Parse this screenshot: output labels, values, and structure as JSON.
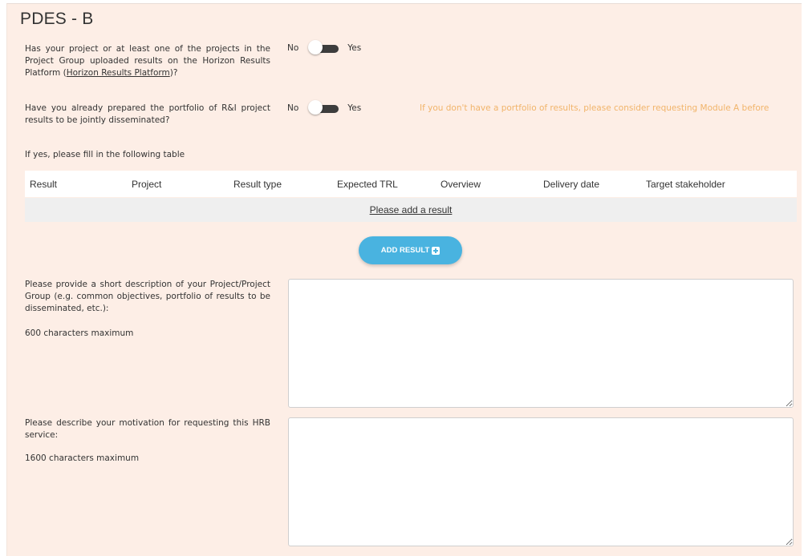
{
  "title": "PDES - B",
  "questions": {
    "q1": {
      "text_before": "Has your project or at least one of the projects in the Project Group uploaded results on the Horizon Results Platform (",
      "link": "Horizon Results Platform",
      "text_after": ")?",
      "no_label": "No",
      "yes_label": "Yes"
    },
    "q2": {
      "text": "Have you already prepared the portfolio of R&I project results to be jointly disseminated?",
      "no_label": "No",
      "yes_label": "Yes",
      "notice": "If you don't have a portfolio of results, please consider requesting Module A before"
    },
    "table_intro": "If yes, please fill in the following table"
  },
  "table": {
    "columns": [
      "Result",
      "Project",
      "Result type",
      "Expected TRL",
      "Overview",
      "Delivery date",
      "Target stakeholder"
    ],
    "empty_link": "Please add a result"
  },
  "add_button": {
    "label": "ADD RESULT",
    "icon": "plus-square-icon"
  },
  "description": {
    "label": "Please provide a short description of your Project/Project Group (e.g. common objectives, portfolio of results to be disseminated, etc.):",
    "max": "600 characters maximum",
    "value": ""
  },
  "motivation": {
    "label": "Please describe your motivation for requesting this HRB service:",
    "max": "1600 characters maximum",
    "value": ""
  },
  "colors": {
    "panel_bg": "#fdeee6",
    "accent": "#49b3e0",
    "notice": "#f1b46a"
  }
}
